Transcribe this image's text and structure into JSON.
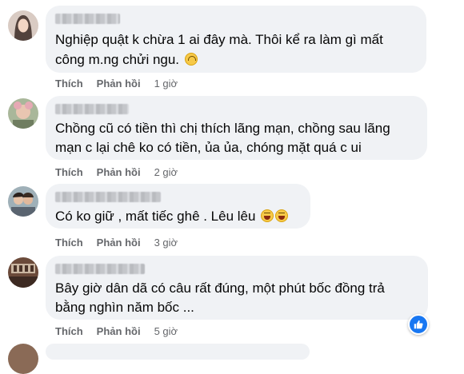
{
  "comments": [
    {
      "lines": [
        "Nghiệp quật k chừa 1 ai đây mà. Thôi kể ra làm gì mất",
        "công m.ng chửi ngu."
      ],
      "emoji": "upside-down-face",
      "like": "Thích",
      "reply": "Phản hồi",
      "time": "1 giờ"
    },
    {
      "lines": [
        "Chồng cũ có tiền thì chị thích lãng mạn, chồng sau lãng",
        "mạn c lại chê ko có tiền, ủa ủa, chóng mặt quá c ui"
      ],
      "like": "Thích",
      "reply": "Phản hồi",
      "time": "2 giờ"
    },
    {
      "lines": [
        "Có ko giữ , mất tiếc ghê . Lêu lêu"
      ],
      "emoji": "laughing-face",
      "like": "Thích",
      "reply": "Phản hồi",
      "time": "3 giờ"
    },
    {
      "lines": [
        "Bây giờ dân dã có câu rất đúng, một phút bốc đồng trả",
        "bằng nghìn năm bốc ..."
      ],
      "like": "Thích",
      "reply": "Phản hồi",
      "time": "5 giờ"
    }
  ],
  "colors": {
    "bubble": "#f0f2f5",
    "meta": "#65676b",
    "like_badge": "#1877f2"
  }
}
